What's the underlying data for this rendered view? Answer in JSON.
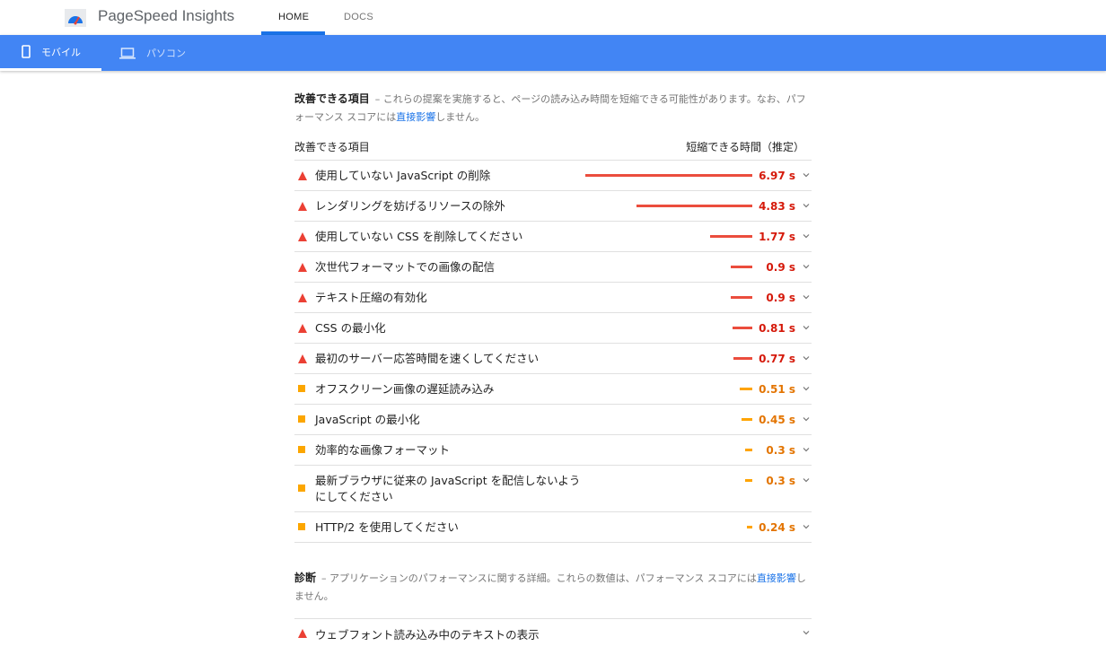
{
  "header": {
    "app_title": "PageSpeed Insights",
    "nav": [
      {
        "label": "HOME",
        "active": true
      },
      {
        "label": "DOCS",
        "active": false
      }
    ]
  },
  "device_tabs": [
    {
      "label": "モバイル",
      "icon": "smartphone-icon",
      "active": true
    },
    {
      "label": "パソコン",
      "icon": "laptop-icon",
      "active": false
    }
  ],
  "opportunities": {
    "title": "改善できる項目",
    "desc_prefix": "– これらの提案を実施すると、ページの読み込み時間を短縮できる可能性があります。なお、パフォーマンス スコアには",
    "desc_link": "直接影響",
    "desc_suffix": "しません。",
    "col_left": "改善できる項目",
    "col_right": "短縮できる時間（推定）",
    "items": [
      {
        "label": "使用していない JavaScript の削除",
        "value": "6.97 s",
        "savings": 6.97,
        "severity": "fail"
      },
      {
        "label": "レンダリングを妨げるリソースの除外",
        "value": "4.83 s",
        "savings": 4.83,
        "severity": "fail"
      },
      {
        "label": "使用していない CSS を削除してください",
        "value": "1.77 s",
        "savings": 1.77,
        "severity": "fail"
      },
      {
        "label": "次世代フォーマットでの画像の配信",
        "value": "0.9 s",
        "savings": 0.9,
        "severity": "fail"
      },
      {
        "label": "テキスト圧縮の有効化",
        "value": "0.9 s",
        "savings": 0.9,
        "severity": "fail"
      },
      {
        "label": "CSS の最小化",
        "value": "0.81 s",
        "savings": 0.81,
        "severity": "fail"
      },
      {
        "label": "最初のサーバー応答時間を速くしてください",
        "value": "0.77 s",
        "savings": 0.77,
        "severity": "fail"
      },
      {
        "label": "オフスクリーン画像の遅延読み込み",
        "value": "0.51 s",
        "savings": 0.51,
        "severity": "average"
      },
      {
        "label": "JavaScript の最小化",
        "value": "0.45 s",
        "savings": 0.45,
        "severity": "average"
      },
      {
        "label": "効率的な画像フォーマット",
        "value": "0.3 s",
        "savings": 0.3,
        "severity": "average"
      },
      {
        "label": "最新ブラウザに従来の JavaScript を配信しないようにしてください",
        "value": "0.3 s",
        "savings": 0.3,
        "severity": "average"
      },
      {
        "label": "HTTP/2 を使用してください",
        "value": "0.24 s",
        "savings": 0.24,
        "severity": "average"
      }
    ]
  },
  "diagnostics": {
    "title": "診断",
    "desc_prefix": "– アプリケーションのパフォーマンスに関する詳細。これらの数値は、パフォーマンス スコアには",
    "desc_link": "直接影響",
    "desc_suffix": "しません。",
    "items": [
      {
        "label": "ウェブフォント読み込み中のテキストの表示",
        "severity": "fail"
      }
    ]
  },
  "colors": {
    "accent_blue": "#4285f4",
    "fail_red": "#eb4034",
    "average_orange": "#ffa400"
  }
}
